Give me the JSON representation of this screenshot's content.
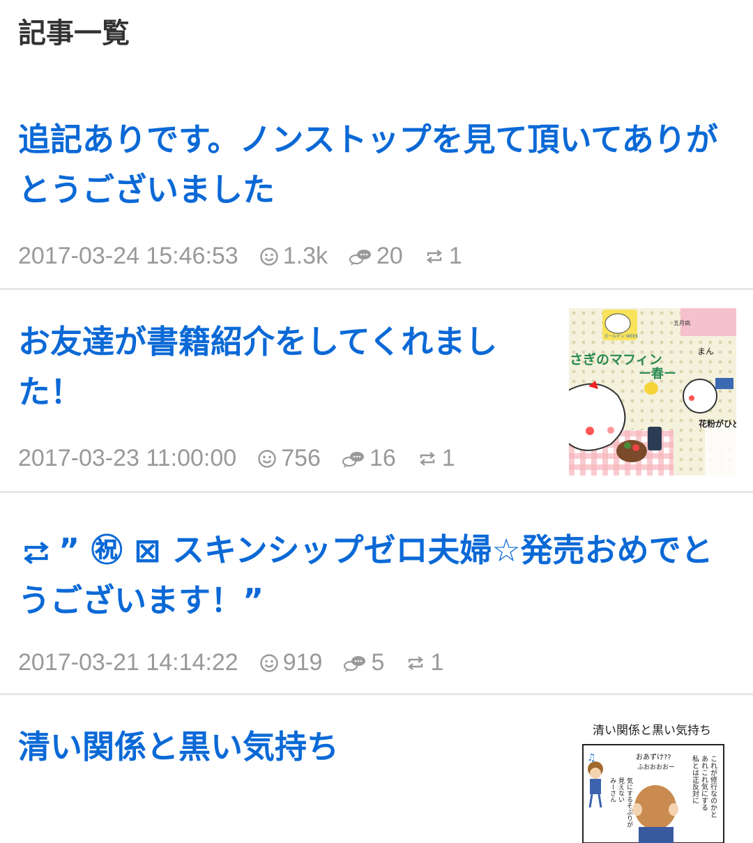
{
  "header": {
    "title": "記事一覧"
  },
  "articles": [
    {
      "title": "追記ありです。ノンストップを見て頂いてありがとうございました",
      "date": "2017-03-24 15:46:53",
      "views": "1.3k",
      "comments": "20",
      "reposts": "1",
      "has_thumbnail": false
    },
    {
      "title": "お友達が書籍紹介をしてくれました！",
      "date": "2017-03-23 11:00:00",
      "views": "756",
      "comments": "16",
      "reposts": "1",
      "has_thumbnail": true,
      "thumbnail": {
        "banner_text": "さぎのマフィン",
        "sub_text": "ー春ー",
        "side_text": "まん",
        "bottom_text": "花粉がひど",
        "badge_text": "ゴールデン WEEK",
        "month_text": "五月病"
      }
    },
    {
      "title_prefix_icon": "repost-icon",
      "title": "” ㊗ ⊠ スキンシップゼロ夫婦☆発売おめでとうございます！”",
      "date": "2017-03-21 14:14:22",
      "views": "919",
      "comments": "5",
      "reposts": "1",
      "has_thumbnail": false
    },
    {
      "title": "清い関係と黒い気持ち",
      "has_thumbnail": true,
      "thumbnail": {
        "heading": "清い関係と黒い気持ち",
        "bubble1": "おあずけ??",
        "bubble2": "ふおおおおー",
        "vertical1": "これが修行なのかと",
        "vertical2": "あれこれ気にする",
        "vertical3": "私とは正反対に",
        "vertical4": "気にするそぶりが",
        "vertical5": "見えない",
        "vertical6": "みーさん"
      }
    }
  ],
  "colors": {
    "link": "#0b69d6",
    "meta": "#999999",
    "heading": "#333333",
    "divider": "#e6e6e6"
  }
}
